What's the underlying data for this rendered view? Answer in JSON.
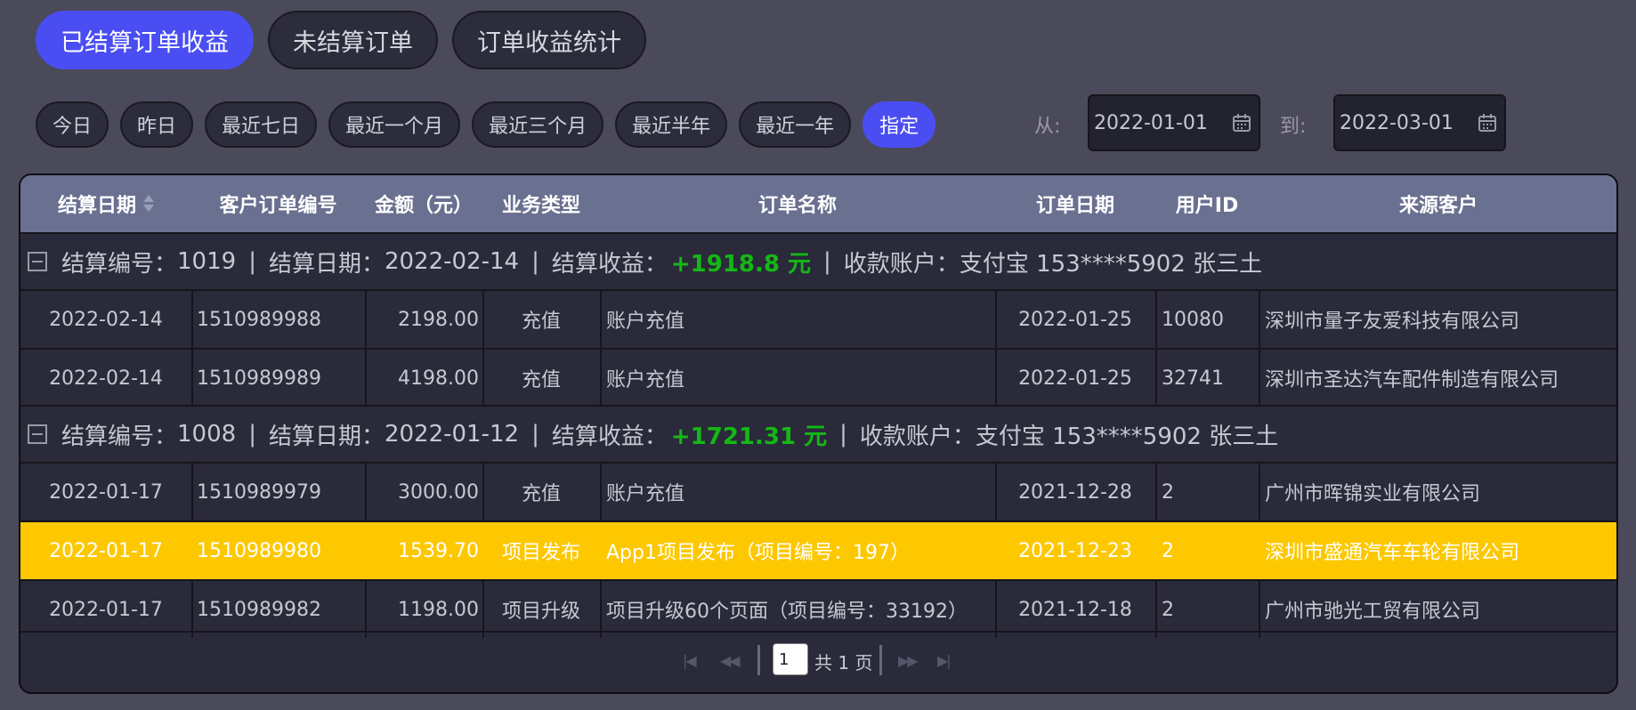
{
  "tabs": [
    "已结算订单收益",
    "未结算订单",
    "订单收益统计"
  ],
  "ranges": [
    "今日",
    "昨日",
    "最近七日",
    "最近一个月",
    "最近三个月",
    "最近半年",
    "最近一年",
    "指定"
  ],
  "date_from": {
    "label": "从:",
    "value": "2022-01-01"
  },
  "date_to": {
    "label": "到:",
    "value": "2022-03-01"
  },
  "columns": [
    "结算日期",
    "客户订单编号",
    "金额（元）",
    "业务类型",
    "订单名称",
    "订单日期",
    "用户ID",
    "来源客户"
  ],
  "groups": [
    {
      "id_label": "结算编号：",
      "id": "1019",
      "date_label": "结算日期：",
      "date": "2022-02-14",
      "profit_label": "结算收益：",
      "profit": "+1918.8 元",
      "account_label": "收款账户：",
      "account": "支付宝 153****5902 张三土",
      "rows": [
        [
          "2022-02-14",
          "1510989988",
          "2198.00",
          "充值",
          "账户充值",
          "2022-01-25",
          "10080",
          "深圳市量子友爱科技有限公司"
        ],
        [
          "2022-02-14",
          "1510989989",
          "4198.00",
          "充值",
          "账户充值",
          "2022-01-25",
          "32741",
          "深圳市圣达汽车配件制造有限公司"
        ]
      ]
    },
    {
      "id_label": "结算编号：",
      "id": "1008",
      "date_label": "结算日期：",
      "date": "2022-01-12",
      "profit_label": "结算收益：",
      "profit": "+1721.31 元",
      "account_label": "收款账户：",
      "account": "支付宝 153****5902 张三土",
      "rows": [
        [
          "2022-01-17",
          "1510989979",
          "3000.00",
          "充值",
          "账户充值",
          "2021-12-28",
          "2",
          "广州市晖锦实业有限公司"
        ],
        [
          "2022-01-17",
          "1510989980",
          "1539.70",
          "项目发布",
          "App1项目发布（项目编号：197）",
          "2021-12-23",
          "2",
          "深圳市盛通汽车车轮有限公司"
        ],
        [
          "2022-01-17",
          "1510989982",
          "1198.00",
          "项目升级",
          "项目升级60个页面（项目编号：33192）",
          "2021-12-18",
          "2",
          "广州市驰光工贸有限公司"
        ]
      ]
    }
  ],
  "pager": {
    "page": "1",
    "total_text": "共 1 页"
  },
  "colors": {
    "accent": "#4a4ef2",
    "highlight": "#fdc800",
    "profit": "#14b814",
    "header": "#6a7090"
  }
}
